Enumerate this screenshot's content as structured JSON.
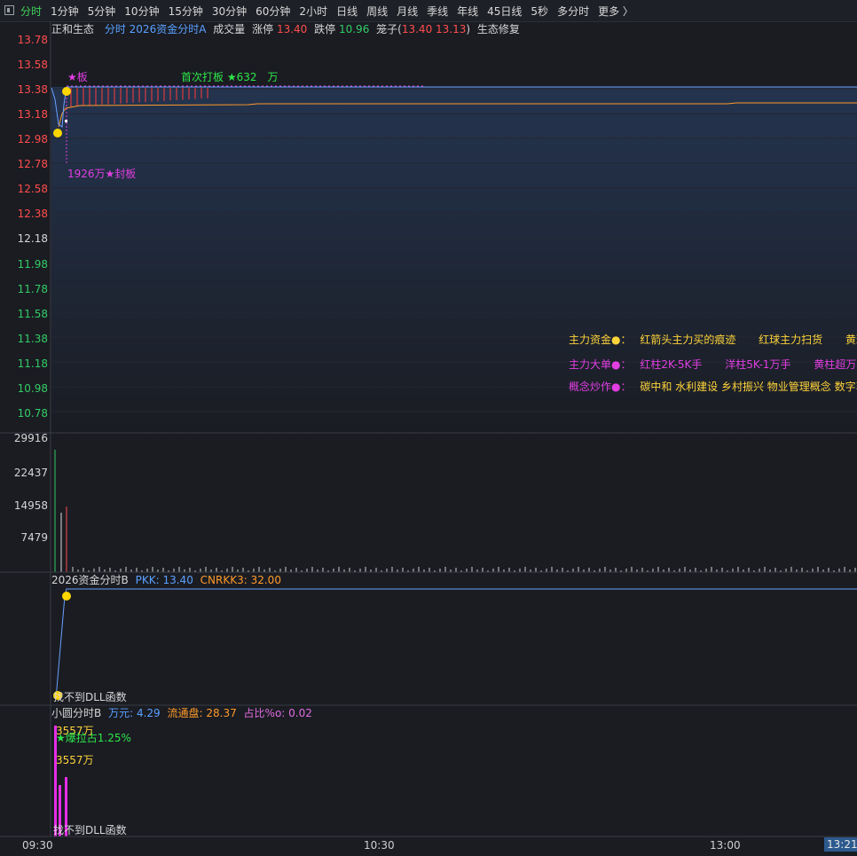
{
  "tabs": [
    {
      "label": "分时",
      "active": true
    },
    {
      "label": "1分钟"
    },
    {
      "label": "5分钟"
    },
    {
      "label": "10分钟"
    },
    {
      "label": "15分钟"
    },
    {
      "label": "30分钟"
    },
    {
      "label": "60分钟"
    },
    {
      "label": "2小时"
    },
    {
      "label": "日线"
    },
    {
      "label": "周线"
    },
    {
      "label": "月线"
    },
    {
      "label": "季线"
    },
    {
      "label": "年线"
    },
    {
      "label": "45日线"
    },
    {
      "label": "5秒"
    },
    {
      "label": "多分时"
    },
    {
      "label": "更多 〉"
    }
  ],
  "info": {
    "stock_name": "正和生态",
    "indicator": "分时 2026资金分时A",
    "volume_label": "成交量",
    "limit_up_label": "涨停",
    "limit_up": "13.40",
    "limit_down_label": "跌停",
    "limit_down": "10.96",
    "cage_label": "笼子(",
    "cage_values": "13.40 13.13",
    "cage_close": ")",
    "concept": "生态修复"
  },
  "price_axis": {
    "red": [
      "13.78",
      "13.58",
      "13.38",
      "13.18",
      "12.98",
      "12.78",
      "12.58",
      "12.38"
    ],
    "mid": "12.18",
    "green": [
      "11.98",
      "11.78",
      "11.58",
      "11.38",
      "11.18",
      "10.98",
      "10.78"
    ]
  },
  "volume_axis": [
    "29916",
    "22437",
    "14958",
    "7479"
  ],
  "annotations": {
    "star_board": "★板",
    "first_board": "首次打板 ★632　万",
    "seal_board": "1926万★封板"
  },
  "side_panel": {
    "row1_label": "主力资金●：",
    "row1_items": [
      "红箭头主力买的痕迹",
      "红球主力扫货",
      "黄球"
    ],
    "row2_label": "主力大单●：",
    "row2_items": [
      "红柱2K-5K手",
      "洋柱5K-1万手",
      "黄柱超万手"
    ],
    "row3_label": "概念炒作●：",
    "row3_text": "碳中和 水利建设 乡村振兴 物业管理概念 数字孪"
  },
  "panel_b": {
    "title": "2026资金分时B",
    "pkk_label": "PKK:",
    "pkk": "13.40",
    "cnrkk_label": "CNRKK3:",
    "cnrkk": "32.00",
    "dll": "找不到DLL函数"
  },
  "panel_c": {
    "title": "小圆分时B",
    "wanyuan_label": "万元:",
    "wanyuan": "4.29",
    "float_label": "流通盘:",
    "float": "28.37",
    "ratio_label": "占比%o:",
    "ratio": "0.02",
    "amount1": "3557万",
    "burst": "★爆拉占1.25%",
    "amount2": "3557万",
    "dll": "找不到DLL函数"
  },
  "time_axis": [
    "09:30",
    "10:30",
    "13:00",
    "13:21"
  ],
  "colors": {
    "price_line": "#6aa0ff",
    "avg_line": "#ff9a2a",
    "up": "#ff4d4d",
    "down": "#33cc66",
    "marker": "#ffd700",
    "bar": "#e62ee6"
  }
}
